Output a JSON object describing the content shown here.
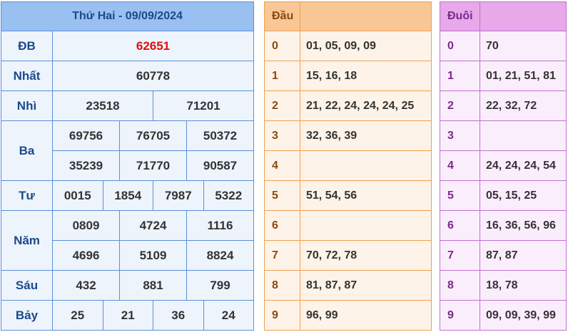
{
  "title": "Thứ Hai - 09/09/2024",
  "prizes": [
    {
      "label": "ĐB",
      "rows": [
        [
          "62651"
        ]
      ],
      "special": true
    },
    {
      "label": "Nhất",
      "rows": [
        [
          "60778"
        ]
      ]
    },
    {
      "label": "Nhì",
      "rows": [
        [
          "23518",
          "71201"
        ]
      ]
    },
    {
      "label": "Ba",
      "rows": [
        [
          "69756",
          "76705",
          "50372"
        ],
        [
          "35239",
          "71770",
          "90587"
        ]
      ]
    },
    {
      "label": "Tư",
      "rows": [
        [
          "0015",
          "1854",
          "7987",
          "5322"
        ]
      ]
    },
    {
      "label": "Năm",
      "rows": [
        [
          "0809",
          "4724",
          "1116"
        ],
        [
          "4696",
          "5109",
          "8824"
        ]
      ]
    },
    {
      "label": "Sáu",
      "rows": [
        [
          "432",
          "881",
          "799"
        ]
      ]
    },
    {
      "label": "Bảy",
      "rows": [
        [
          "25",
          "21",
          "36",
          "24"
        ]
      ]
    }
  ],
  "dau": {
    "header": "Đầu",
    "rows": [
      {
        "k": "0",
        "v": "01, 05, 09, 09"
      },
      {
        "k": "1",
        "v": "15, 16, 18"
      },
      {
        "k": "2",
        "v": "21, 22, 24, 24, 24, 25"
      },
      {
        "k": "3",
        "v": "32, 36, 39"
      },
      {
        "k": "4",
        "v": ""
      },
      {
        "k": "5",
        "v": "51, 54, 56"
      },
      {
        "k": "6",
        "v": ""
      },
      {
        "k": "7",
        "v": "70, 72, 78"
      },
      {
        "k": "8",
        "v": "81, 87, 87"
      },
      {
        "k": "9",
        "v": "96, 99"
      }
    ]
  },
  "duoi": {
    "header": "Đuôi",
    "rows": [
      {
        "k": "0",
        "v": "70"
      },
      {
        "k": "1",
        "v": "01, 21, 51, 81"
      },
      {
        "k": "2",
        "v": "22, 32, 72"
      },
      {
        "k": "3",
        "v": ""
      },
      {
        "k": "4",
        "v": "24, 24, 24, 54"
      },
      {
        "k": "5",
        "v": "05, 15, 25"
      },
      {
        "k": "6",
        "v": "16, 36, 56, 96"
      },
      {
        "k": "7",
        "v": "87, 87"
      },
      {
        "k": "8",
        "v": "18, 78"
      },
      {
        "k": "9",
        "v": "09, 09, 39, 99"
      }
    ]
  }
}
